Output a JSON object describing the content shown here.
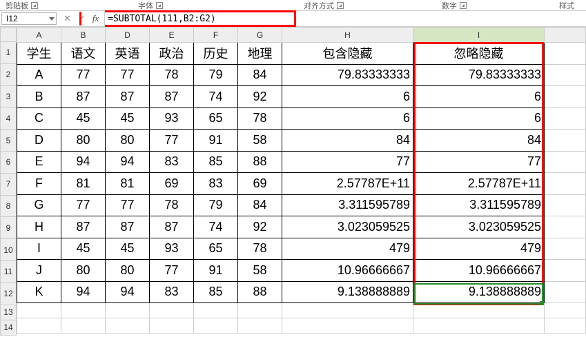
{
  "ribbon": {
    "clipboard": "剪贴板",
    "font": "字体",
    "alignment": "对齐方式",
    "number": "数字",
    "styles": "样式"
  },
  "namebox": "I12",
  "formula": "=SUBTOTAL(111,B2:G2)",
  "column_letters": [
    "A",
    "B",
    "D",
    "E",
    "F",
    "G",
    "H",
    "I"
  ],
  "row_numbers": [
    "1",
    "2",
    "3",
    "4",
    "5",
    "6",
    "7",
    "8",
    "9",
    "10",
    "11",
    "12",
    "13",
    "14"
  ],
  "chart_data": {
    "type": "table",
    "headers": [
      "学生",
      "语文",
      "英语",
      "政治",
      "历史",
      "地理",
      "包含隐藏",
      "忽略隐藏"
    ],
    "rows": [
      [
        "A",
        "77",
        "77",
        "78",
        "79",
        "84",
        "79.83333333",
        "79.83333333"
      ],
      [
        "B",
        "87",
        "87",
        "87",
        "74",
        "92",
        "6",
        "6"
      ],
      [
        "C",
        "45",
        "45",
        "93",
        "65",
        "78",
        "6",
        "6"
      ],
      [
        "D",
        "80",
        "80",
        "77",
        "91",
        "58",
        "84",
        "84"
      ],
      [
        "E",
        "94",
        "94",
        "83",
        "85",
        "88",
        "77",
        "77"
      ],
      [
        "F",
        "81",
        "81",
        "69",
        "83",
        "69",
        "2.57787E+11",
        "2.57787E+11"
      ],
      [
        "G",
        "77",
        "77",
        "78",
        "79",
        "84",
        "3.311595789",
        "3.311595789"
      ],
      [
        "H",
        "87",
        "87",
        "87",
        "74",
        "92",
        "3.023059525",
        "3.023059525"
      ],
      [
        "I",
        "45",
        "45",
        "93",
        "65",
        "78",
        "479",
        "479"
      ],
      [
        "J",
        "80",
        "80",
        "77",
        "91",
        "58",
        "10.96666667",
        "10.96666667"
      ],
      [
        "K",
        "94",
        "94",
        "83",
        "85",
        "88",
        "9.138888889",
        "9.138888889"
      ]
    ]
  }
}
